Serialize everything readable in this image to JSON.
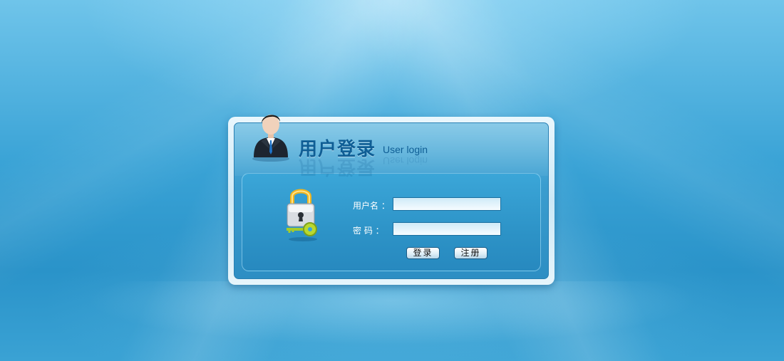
{
  "login": {
    "title_cn": "用户登录",
    "title_en": "User login",
    "username_label": "用户名 ：",
    "username_value": "",
    "password_label": "密  码 ：",
    "password_value": "",
    "login_button": "登录",
    "register_button": "注册"
  },
  "colors": {
    "background": "#3aa3d6",
    "panel_border": "#eaf7fd",
    "title_text": "#0f5e95",
    "label_text": "#ffffff"
  },
  "icons": [
    "businessman-avatar-icon",
    "padlock-key-icon"
  ]
}
